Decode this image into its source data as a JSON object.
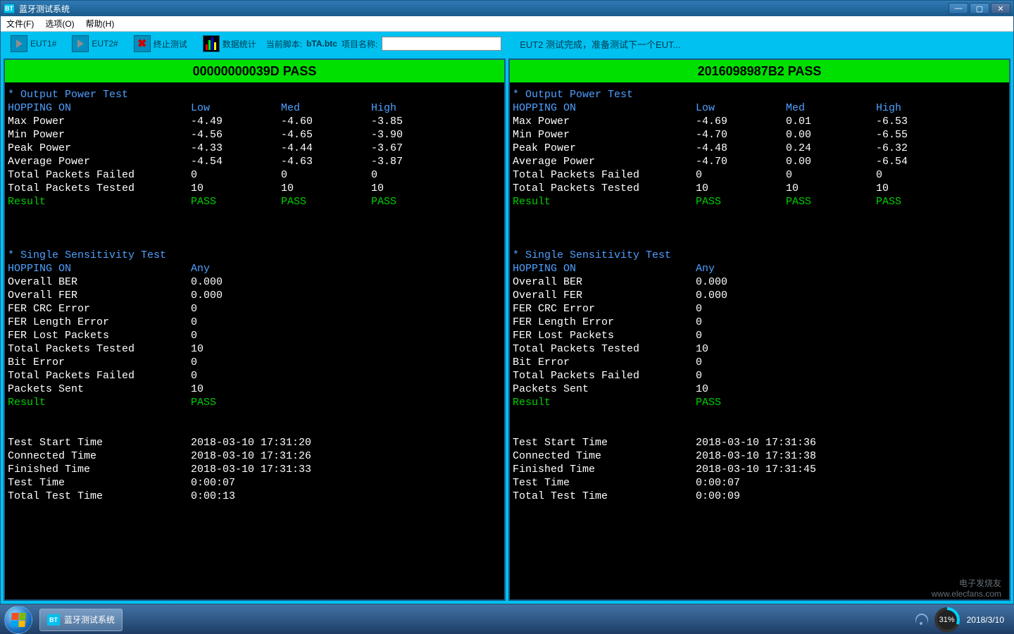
{
  "window": {
    "title": "蓝牙测试系统",
    "app_icon_text": "BT"
  },
  "menubar": {
    "file": "文件(F)",
    "options": "选项(O)",
    "help": "帮助(H)"
  },
  "toolbar": {
    "eut1": "EUT1#",
    "eut2": "EUT2#",
    "stop_test": "终止测试",
    "stats": "数据统计",
    "current_script_label": "当前脚本:",
    "current_script_value": "bTA.btc",
    "project_name_label": "项目名称:",
    "project_name_value": "",
    "status_message": "EUT2 测试完成，准备测试下一个EUT..."
  },
  "panes": [
    {
      "banner": "00000000039D PASS",
      "power_test": {
        "title": "* Output Power Test",
        "hopping_label": "HOPPING ON",
        "headers": [
          "Low",
          "Med",
          "High"
        ],
        "rows": [
          {
            "label": "Max Power",
            "vals": [
              "-4.49",
              "-4.60",
              "-3.85"
            ]
          },
          {
            "label": "Min Power",
            "vals": [
              "-4.56",
              "-4.65",
              "-3.90"
            ]
          },
          {
            "label": "Peak Power",
            "vals": [
              "-4.33",
              "-4.44",
              "-3.67"
            ]
          },
          {
            "label": "Average Power",
            "vals": [
              "-4.54",
              "-4.63",
              "-3.87"
            ]
          },
          {
            "label": "Total Packets Failed",
            "vals": [
              "0",
              "0",
              "0"
            ]
          },
          {
            "label": "Total Packets Tested",
            "vals": [
              "10",
              "10",
              "10"
            ]
          }
        ],
        "result_label": "Result",
        "result_vals": [
          "PASS",
          "PASS",
          "PASS"
        ]
      },
      "sens_test": {
        "title": "* Single Sensitivity Test",
        "hopping_label": "HOPPING ON",
        "header": "Any",
        "rows": [
          {
            "label": "Overall BER",
            "val": "0.000"
          },
          {
            "label": "Overall FER",
            "val": "0.000"
          },
          {
            "label": "FER CRC Error",
            "val": "0"
          },
          {
            "label": "FER Length Error",
            "val": "0"
          },
          {
            "label": "FER Lost Packets",
            "val": "0"
          },
          {
            "label": "Total Packets Tested",
            "val": "10"
          },
          {
            "label": "Bit Error",
            "val": "0"
          },
          {
            "label": "Total Packets Failed",
            "val": "0"
          },
          {
            "label": "Packets Sent",
            "val": "10"
          }
        ],
        "result_label": "Result",
        "result_val": "PASS"
      },
      "times": [
        {
          "label": "Test Start Time",
          "val": "2018-03-10 17:31:20"
        },
        {
          "label": "Connected Time",
          "val": "2018-03-10 17:31:26"
        },
        {
          "label": "Finished Time",
          "val": "2018-03-10 17:31:33"
        },
        {
          "label": "Test Time",
          "val": "0:00:07"
        },
        {
          "label": "Total Test Time",
          "val": "0:00:13"
        }
      ]
    },
    {
      "banner": "2016098987B2 PASS",
      "power_test": {
        "title": "* Output Power Test",
        "hopping_label": "HOPPING ON",
        "headers": [
          "Low",
          "Med",
          "High"
        ],
        "rows": [
          {
            "label": "Max Power",
            "vals": [
              "-4.69",
              "0.01",
              "-6.53"
            ]
          },
          {
            "label": "Min Power",
            "vals": [
              "-4.70",
              "0.00",
              "-6.55"
            ]
          },
          {
            "label": "Peak Power",
            "vals": [
              "-4.48",
              "0.24",
              "-6.32"
            ]
          },
          {
            "label": "Average Power",
            "vals": [
              "-4.70",
              "0.00",
              "-6.54"
            ]
          },
          {
            "label": "Total Packets Failed",
            "vals": [
              "0",
              "0",
              "0"
            ]
          },
          {
            "label": "Total Packets Tested",
            "vals": [
              "10",
              "10",
              "10"
            ]
          }
        ],
        "result_label": "Result",
        "result_vals": [
          "PASS",
          "PASS",
          "PASS"
        ]
      },
      "sens_test": {
        "title": "* Single Sensitivity Test",
        "hopping_label": "HOPPING ON",
        "header": "Any",
        "rows": [
          {
            "label": "Overall BER",
            "val": "0.000"
          },
          {
            "label": "Overall FER",
            "val": "0.000"
          },
          {
            "label": "FER CRC Error",
            "val": "0"
          },
          {
            "label": "FER Length Error",
            "val": "0"
          },
          {
            "label": "FER Lost Packets",
            "val": "0"
          },
          {
            "label": "Total Packets Tested",
            "val": "10"
          },
          {
            "label": "Bit Error",
            "val": "0"
          },
          {
            "label": "Total Packets Failed",
            "val": "0"
          },
          {
            "label": "Packets Sent",
            "val": "10"
          }
        ],
        "result_label": "Result",
        "result_val": "PASS"
      },
      "times": [
        {
          "label": "Test Start Time",
          "val": "2018-03-10 17:31:36"
        },
        {
          "label": "Connected Time",
          "val": "2018-03-10 17:31:38"
        },
        {
          "label": "Finished Time",
          "val": "2018-03-10 17:31:45"
        },
        {
          "label": "Test Time",
          "val": "0:00:07"
        },
        {
          "label": "Total Test Time",
          "val": "0:00:09"
        }
      ]
    }
  ],
  "taskbar": {
    "app_label": "蓝牙测试系统",
    "date": "2018/3/10",
    "battery_pct": "31%"
  },
  "watermark": {
    "line1": "电子发烧友",
    "line2": "www.elecfans.com"
  }
}
